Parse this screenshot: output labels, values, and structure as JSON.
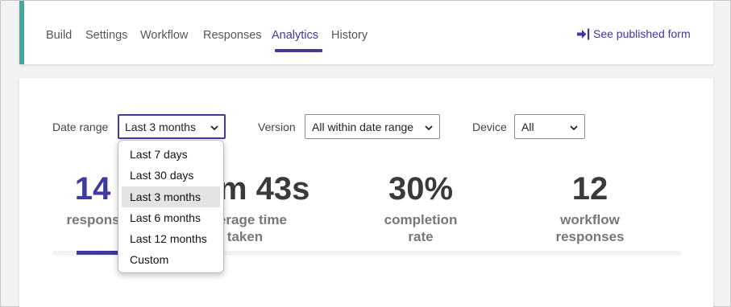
{
  "nav": {
    "tabs": [
      {
        "label": "Build"
      },
      {
        "label": "Settings"
      },
      {
        "label": "Workflow"
      },
      {
        "label": "Responses"
      },
      {
        "label": "Analytics",
        "active": true
      },
      {
        "label": "History"
      }
    ],
    "published_link": "See published form"
  },
  "filters": {
    "date_range": {
      "label": "Date range",
      "value": "Last 3 months"
    },
    "version": {
      "label": "Version",
      "value": "All within date range"
    },
    "device": {
      "label": "Device",
      "value": "All"
    }
  },
  "stats": [
    {
      "value": "14",
      "label": "responses"
    },
    {
      "value": "m 43s",
      "label_line1": "average time",
      "label_line2": "taken"
    },
    {
      "value": "30%",
      "label_line1": "completion",
      "label_line2": "rate"
    },
    {
      "value": "12",
      "label_line1": "workflow",
      "label_line2": "responses"
    }
  ],
  "dropdown": {
    "options": [
      "Last 7 days",
      "Last 30 days",
      "Last 3 months",
      "Last 6 months",
      "Last 12 months",
      "Custom"
    ],
    "selected": "Last 3 months"
  },
  "colors": {
    "accent": "#3e3a9e",
    "nav_left_border": "#4aa59b",
    "text_dark": "#3a3a3a",
    "text_muted": "#777777"
  },
  "icons": {
    "published_link": "arrow-into-bar-icon",
    "select_chevron": "chevron-down-icon"
  }
}
